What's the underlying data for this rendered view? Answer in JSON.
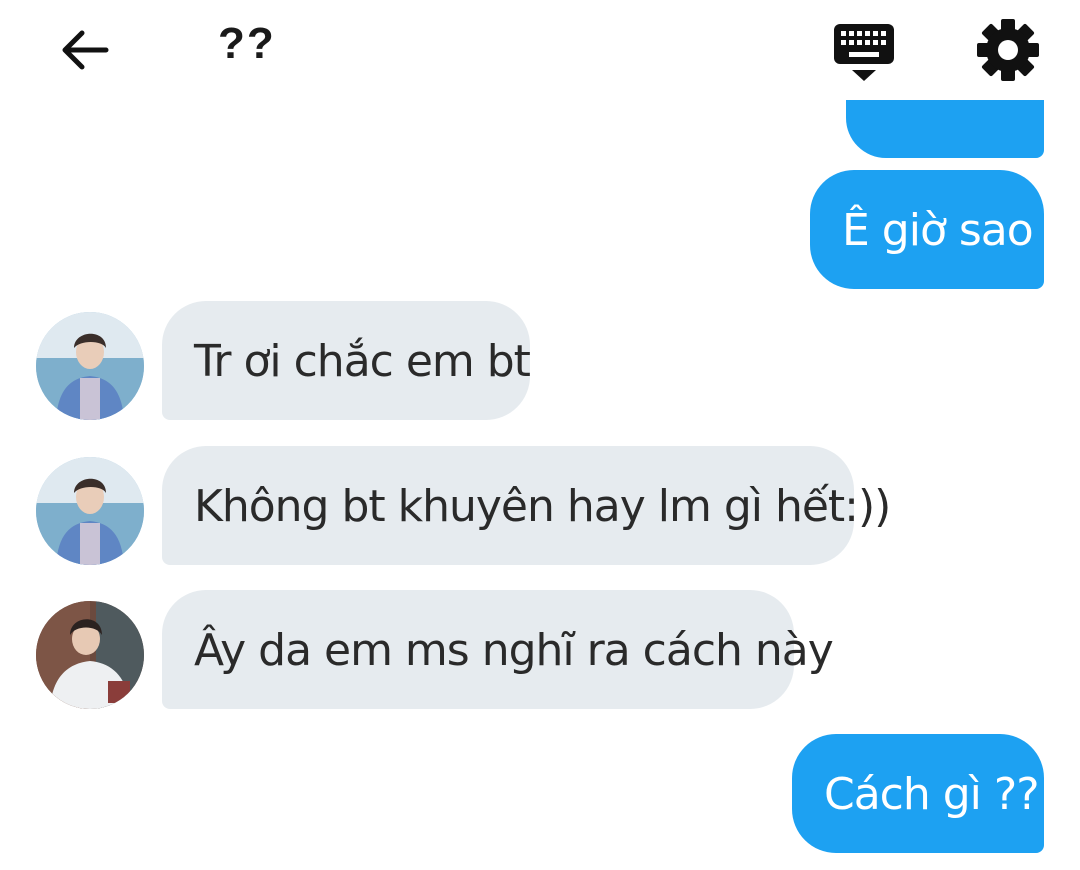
{
  "header": {
    "title": "??",
    "back_icon": "arrow-left-icon",
    "keyboard_icon": "keyboard-icon",
    "settings_icon": "gear-icon"
  },
  "colors": {
    "outgoing_bubble": "#1da1f2",
    "incoming_bubble": "#e6ebef",
    "incoming_text": "#2a2a2a",
    "outgoing_text": "#ffffff"
  },
  "messages": [
    {
      "direction": "outgoing",
      "text": "Ê giờ sao"
    },
    {
      "direction": "incoming",
      "avatar": "avatar-1",
      "text": "Tr ơi chắc em bt"
    },
    {
      "direction": "incoming",
      "avatar": "avatar-1",
      "text": "Không bt khuyên hay lm gì hết:))"
    },
    {
      "direction": "incoming",
      "avatar": "avatar-2",
      "text": "Ây da em ms nghĩ ra cách này"
    },
    {
      "direction": "outgoing",
      "text": "Cách gì ??"
    }
  ]
}
